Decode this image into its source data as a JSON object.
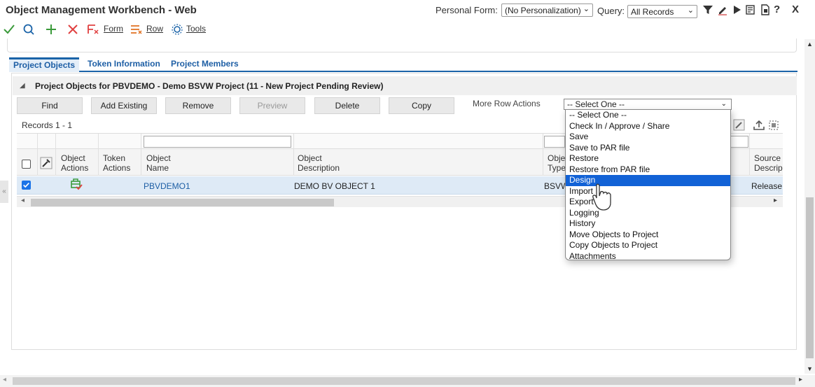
{
  "header": {
    "title": "Object Management Workbench - Web",
    "personal_form_label": "Personal Form:",
    "personal_form_value": "(No Personalization)",
    "query_label": "Query:",
    "query_value": "All Records",
    "help_label": "?",
    "close_label": "X"
  },
  "toolbar": {
    "form_label": "Form",
    "row_label": "Row",
    "tools_label": "Tools"
  },
  "tabs": [
    {
      "label": "Project Objects"
    },
    {
      "label": "Token Information"
    },
    {
      "label": "Project Members"
    }
  ],
  "panel": {
    "title": "Project Objects for PBVDEMO - Demo BSVW Project  (11 - New Project Pending Review)",
    "buttons": {
      "find": "Find",
      "add_existing": "Add Existing",
      "remove": "Remove",
      "preview": "Preview",
      "delete": "Delete",
      "copy": "Copy"
    },
    "more_row_actions_label": "More Row Actions",
    "more_row_actions_value": "-- Select One --",
    "records": "Records 1 - 1"
  },
  "grid": {
    "columns": {
      "object_actions": "Object\nActions",
      "token_actions": "Token\nActions",
      "object_name": "Object\nName",
      "object_description": "Object\nDescription",
      "object_type": "Obje\nType",
      "source_description": "Source\nDescrip"
    },
    "row": {
      "object_name": "PBVDEMO1",
      "object_description": "DEMO BV OBJECT 1",
      "object_type": "BSVW",
      "source_description": "Release"
    }
  },
  "dropdown": {
    "options": [
      "-- Select One --",
      "Check In / Approve / Share",
      "Save",
      "Save to PAR file",
      "Restore",
      "Restore from PAR file",
      "Design",
      "Import",
      "Export",
      "Logging",
      "History",
      "Move Objects to Project",
      "Copy Objects to Project",
      "Attachments"
    ],
    "highlighted": "Design"
  },
  "colors": {
    "accent": "#1a63a8",
    "selection": "#1262d6",
    "row_highlight": "#deeaf6",
    "ok_green": "#3a9a3a",
    "cancel_red": "#e04040"
  }
}
